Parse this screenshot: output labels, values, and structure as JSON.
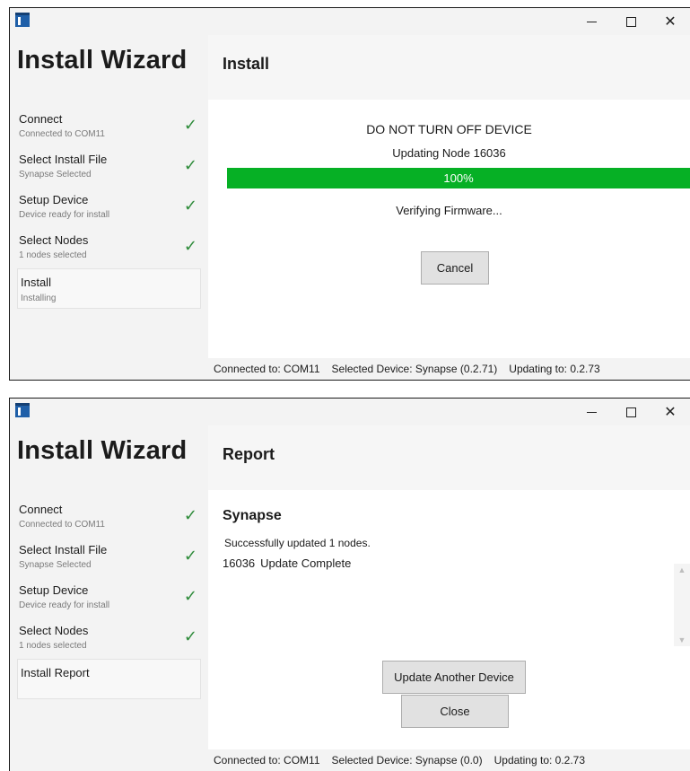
{
  "window1": {
    "wizard_title": "Install Wizard",
    "page_title": "Install",
    "steps": [
      {
        "name": "Connect",
        "sub": "Connected to COM11",
        "done": true
      },
      {
        "name": "Select Install File",
        "sub": "Synapse Selected",
        "done": true
      },
      {
        "name": "Setup Device",
        "sub": "Device ready for install",
        "done": true
      },
      {
        "name": "Select Nodes",
        "sub": "1 nodes selected",
        "done": true
      },
      {
        "name": "Install",
        "sub": "Installing",
        "done": false
      }
    ],
    "check_glyph": "✓",
    "warning": "DO NOT TURN OFF DEVICE",
    "updating": "Updating Node 16036",
    "progress": {
      "value": 100,
      "label": "100%"
    },
    "verify": "Verifying Firmware...",
    "cancel_label": "Cancel",
    "status": {
      "connected": "Connected to: COM11",
      "device": "Selected Device: Synapse (0.2.71)",
      "updating_to": "Updating to: 0.2.73"
    }
  },
  "window2": {
    "wizard_title": "Install Wizard",
    "page_title": "Report",
    "steps": [
      {
        "name": "Connect",
        "sub": "Connected to COM11",
        "done": true
      },
      {
        "name": "Select Install File",
        "sub": "Synapse Selected",
        "done": true
      },
      {
        "name": "Setup Device",
        "sub": "Device ready for install",
        "done": true
      },
      {
        "name": "Select Nodes",
        "sub": "1 nodes selected",
        "done": true
      },
      {
        "name": "Install Report",
        "sub": "",
        "done": false
      }
    ],
    "check_glyph": "✓",
    "report_title": "Synapse",
    "summary": "Successfully updated 1 nodes.",
    "results": [
      {
        "node": "16036",
        "status": "Update Complete"
      }
    ],
    "another_label": "Update Another Device",
    "close_label": "Close",
    "status": {
      "connected": "Connected to: COM11",
      "device": "Selected Device: Synapse (0.0)",
      "updating_to": "Updating to: 0.2.73"
    }
  },
  "titlebar": {
    "minimize_icon": "minimize-icon",
    "maximize_icon": "maximize-icon",
    "close_glyph": "✕"
  },
  "colors": {
    "progress_green": "#06b025",
    "check_green": "#2e8b3a",
    "app_icon_blue": "#1f5fa8"
  }
}
